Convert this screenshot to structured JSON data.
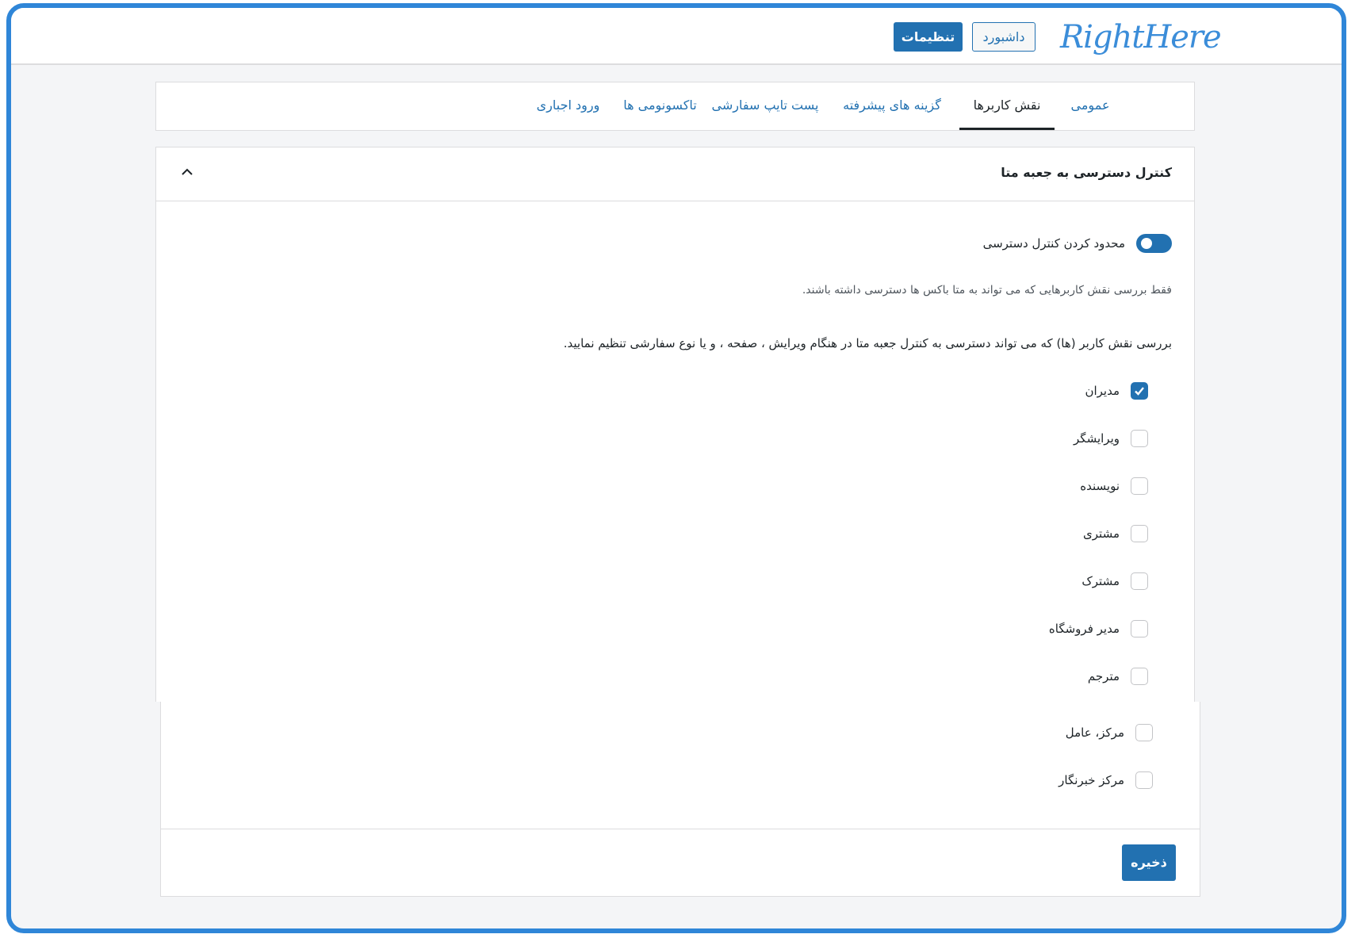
{
  "header": {
    "logo_text": "RightHere",
    "dashboard_label": "داشبورد",
    "settings_label": "تنظیمات"
  },
  "tabs": [
    {
      "label": "عمومی"
    },
    {
      "label": "نقش کاربرها",
      "active": true
    },
    {
      "label": "گزینه های پیشرفته"
    },
    {
      "label": "پست تایپ سفارشی"
    },
    {
      "label": "تاکسونومی ها"
    },
    {
      "label": "ورود اجباری"
    }
  ],
  "panel": {
    "title": "کنترل دسترسی به جعبه متا",
    "toggle_label": "محدود کردن کنترل دسترسی",
    "toggle_on": true,
    "description_1": "فقط بررسی نقش کاربرهایی که می تواند به متا باکس ها دسترسی داشته باشند.",
    "description_2": "بررسی نقش کاربر (ها) که می تواند دسترسی به کنترل جعبه متا در هنگام ویرایش ، صفحه ، و یا نوع سفارشی تنظیم نمایید.",
    "roles": [
      {
        "label": "مدیران",
        "checked": true
      },
      {
        "label": "ویرایشگر",
        "checked": false
      },
      {
        "label": "نویسنده",
        "checked": false
      },
      {
        "label": "مشتری",
        "checked": false
      },
      {
        "label": "مشترک",
        "checked": false
      },
      {
        "label": "مدیر فروشگاه",
        "checked": false
      },
      {
        "label": "مترجم",
        "checked": false
      },
      {
        "label": "مرکز، عامل",
        "checked": false
      },
      {
        "label": "مرکز خبرنگار",
        "checked": false
      }
    ],
    "save_label": "ذخیره"
  },
  "colors": {
    "accent": "#2271b1",
    "frame_border": "#2f86d8",
    "logo": "#3b8dd9"
  }
}
